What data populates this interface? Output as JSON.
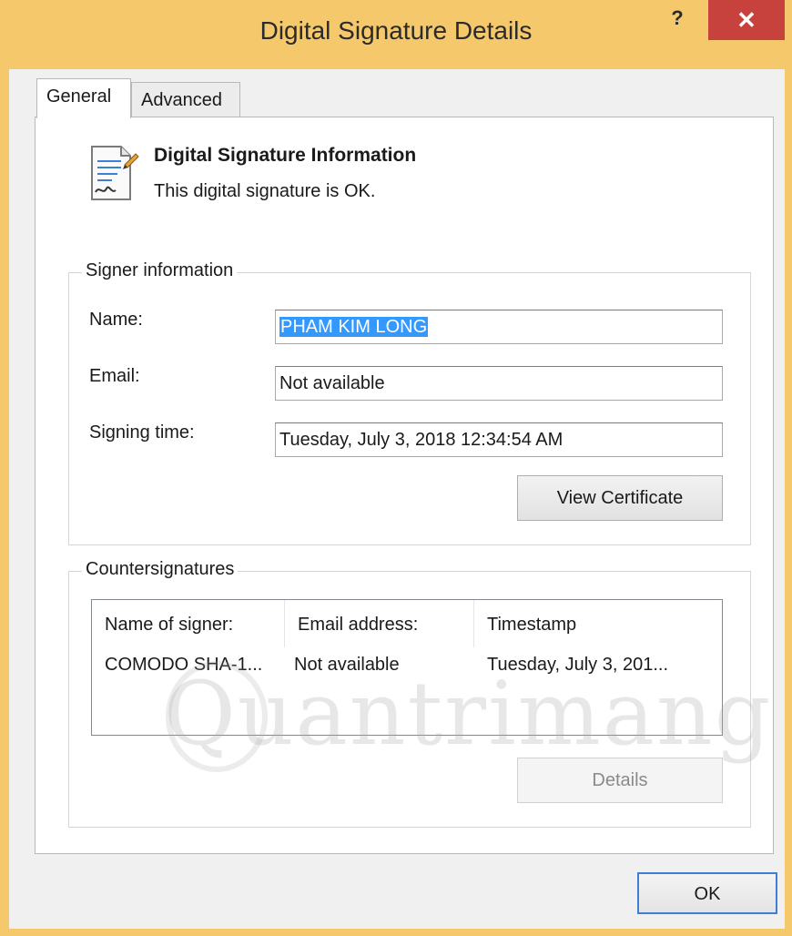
{
  "window": {
    "title": "Digital Signature Details",
    "help_label": "?",
    "close_label": "✕"
  },
  "tabs": [
    {
      "label": "General"
    },
    {
      "label": "Advanced"
    }
  ],
  "info": {
    "heading": "Digital Signature Information",
    "status": "This digital signature is OK."
  },
  "signer": {
    "legend": "Signer information",
    "name_label": "Name:",
    "name_value": "PHAM KIM LONG",
    "email_label": "Email:",
    "email_value": "Not available",
    "time_label": "Signing time:",
    "time_value": "Tuesday, July 3, 2018 12:34:54 AM",
    "view_certificate_label": "View Certificate"
  },
  "countersignatures": {
    "legend": "Countersignatures",
    "columns": [
      "Name of signer:",
      "Email address:",
      "Timestamp"
    ],
    "rows": [
      [
        "COMODO SHA-1...",
        "Not available",
        "Tuesday, July 3, 201..."
      ]
    ],
    "details_label": "Details"
  },
  "footer": {
    "ok_label": "OK"
  },
  "watermark": {
    "text": "Quantrimang"
  },
  "colors": {
    "window_frame": "#f5c96b",
    "close_button": "#c8423d",
    "selection": "#3399ff",
    "ok_border": "#3c7fd6"
  }
}
